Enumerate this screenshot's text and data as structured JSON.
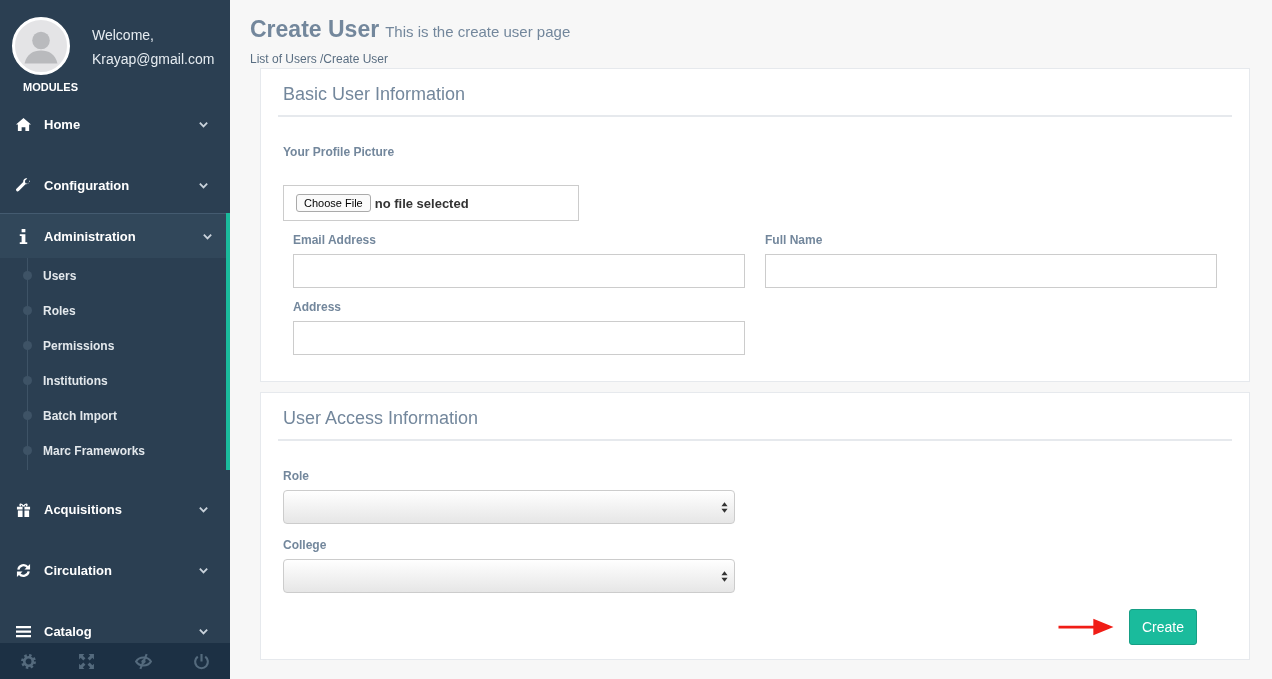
{
  "sidebar": {
    "greeting": "Welcome,",
    "email": "Krayap@gmail.com",
    "modules_label": "MODULES",
    "nav": [
      {
        "label": "Home",
        "expanded": false
      },
      {
        "label": "Configuration",
        "expanded": false
      },
      {
        "label": "Administration",
        "expanded": true,
        "children": [
          {
            "label": "Users"
          },
          {
            "label": "Roles"
          },
          {
            "label": "Permissions"
          },
          {
            "label": "Institutions"
          },
          {
            "label": "Batch Import"
          },
          {
            "label": "Marc Frameworks"
          }
        ]
      },
      {
        "label": "Acquisitions",
        "expanded": false
      },
      {
        "label": "Circulation",
        "expanded": false
      },
      {
        "label": "Catalog",
        "expanded": false
      }
    ]
  },
  "page": {
    "title": "Create User",
    "subtitle": "This is the create user page",
    "breadcrumb": "List of Users /Create User",
    "sections": [
      {
        "title": "Basic User Information",
        "fields": [
          {
            "kind": "file",
            "label": "Your Profile Picture",
            "button": "Choose File",
            "status": "no file selected"
          },
          {
            "kind": "text",
            "label": "Email Address"
          },
          {
            "kind": "text",
            "label": "Full Name"
          },
          {
            "kind": "text",
            "label": "Address"
          }
        ]
      },
      {
        "title": "User Access Information",
        "fields": [
          {
            "kind": "select",
            "label": "Role"
          },
          {
            "kind": "select",
            "label": "College"
          }
        ],
        "submit": "Create"
      }
    ]
  }
}
